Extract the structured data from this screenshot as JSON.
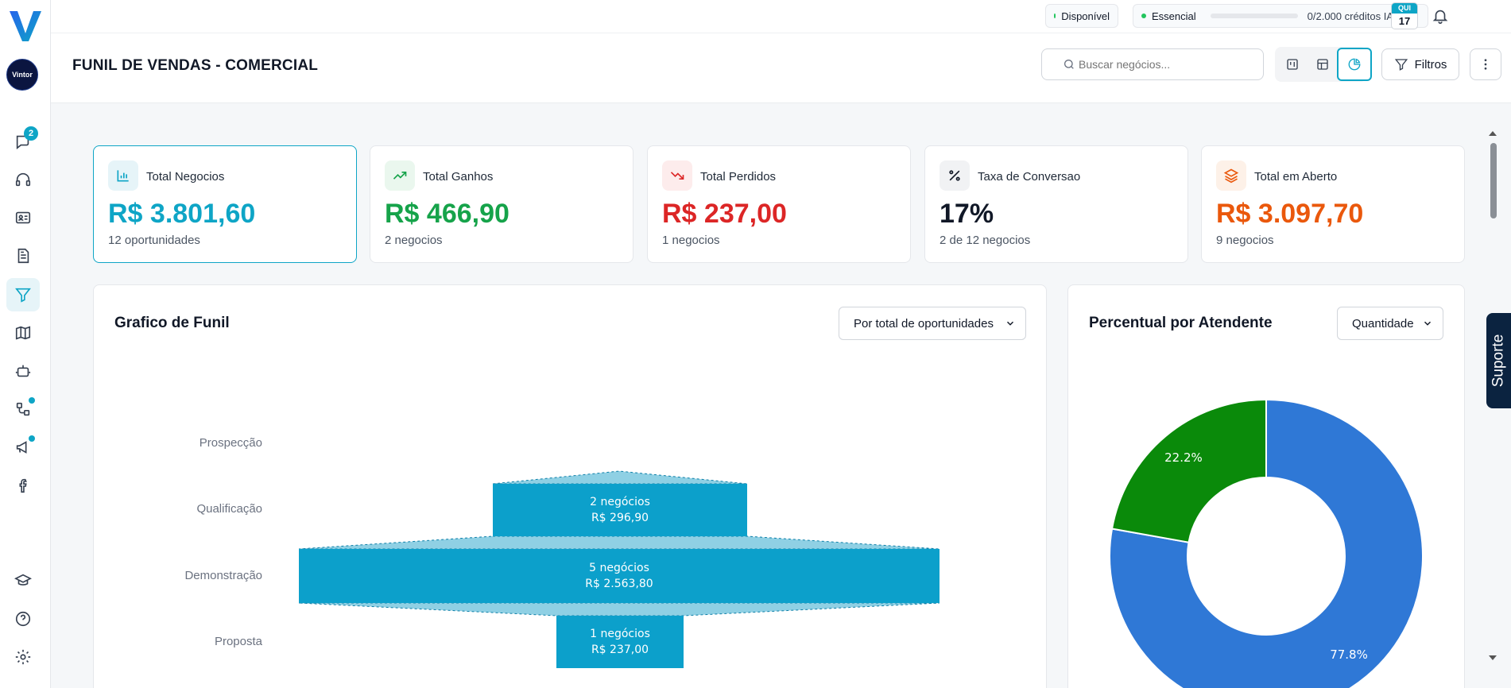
{
  "sidebar": {
    "avatar_text": "Vintor",
    "chat_badge": "2"
  },
  "topbar": {
    "status": "Disponível",
    "plan": "Essencial",
    "credits": "0/2.000 créditos IA · 0%",
    "date_month": "QUI",
    "date_day": "17"
  },
  "header": {
    "title": "FUNIL DE VENDAS - COMERCIAL",
    "search_placeholder": "Buscar negócios...",
    "filter_label": "Filtros"
  },
  "cards": [
    {
      "label": "Total Negocios",
      "value": "R$ 3.801,60",
      "sub": "12 oportunidades",
      "color": "#0ea5c6"
    },
    {
      "label": "Total Ganhos",
      "value": "R$ 466,90",
      "sub": "2 negocios",
      "color": "#16a34a"
    },
    {
      "label": "Total Perdidos",
      "value": "R$ 237,00",
      "sub": "1 negocios",
      "color": "#dc2626"
    },
    {
      "label": "Taxa de Conversao",
      "value": "17%",
      "sub": "2 de 12 negocios",
      "color": "#111827"
    },
    {
      "label": "Total em Aberto",
      "value": "R$ 3.097,70",
      "sub": "9 negocios",
      "color": "#ea580c"
    }
  ],
  "funnel_panel": {
    "title": "Grafico de Funil",
    "select_value": "Por total de oportunidades",
    "stages": [
      {
        "label": "Prospecção",
        "count": 0,
        "line1": "",
        "line2": ""
      },
      {
        "label": "Qualificação",
        "count": 2,
        "line1": "2 negócios",
        "line2": "R$ 296,90"
      },
      {
        "label": "Demonstração",
        "count": 5,
        "line1": "5 negócios",
        "line2": "R$ 2.563,80"
      },
      {
        "label": "Proposta",
        "count": 1,
        "line1": "1 negócios",
        "line2": "R$ 237,00"
      }
    ]
  },
  "pie_panel": {
    "title": "Percentual por Atendente",
    "select_value": "Quantidade"
  },
  "chart_data": {
    "type": "pie",
    "categories": [
      "",
      ""
    ],
    "values": [
      77.8,
      22.2
    ],
    "labels": [
      "77.8%",
      "22.2%"
    ],
    "colors": [
      "#2f78d6",
      "#0a8a0a"
    ]
  },
  "suporte_label": "Suporte"
}
